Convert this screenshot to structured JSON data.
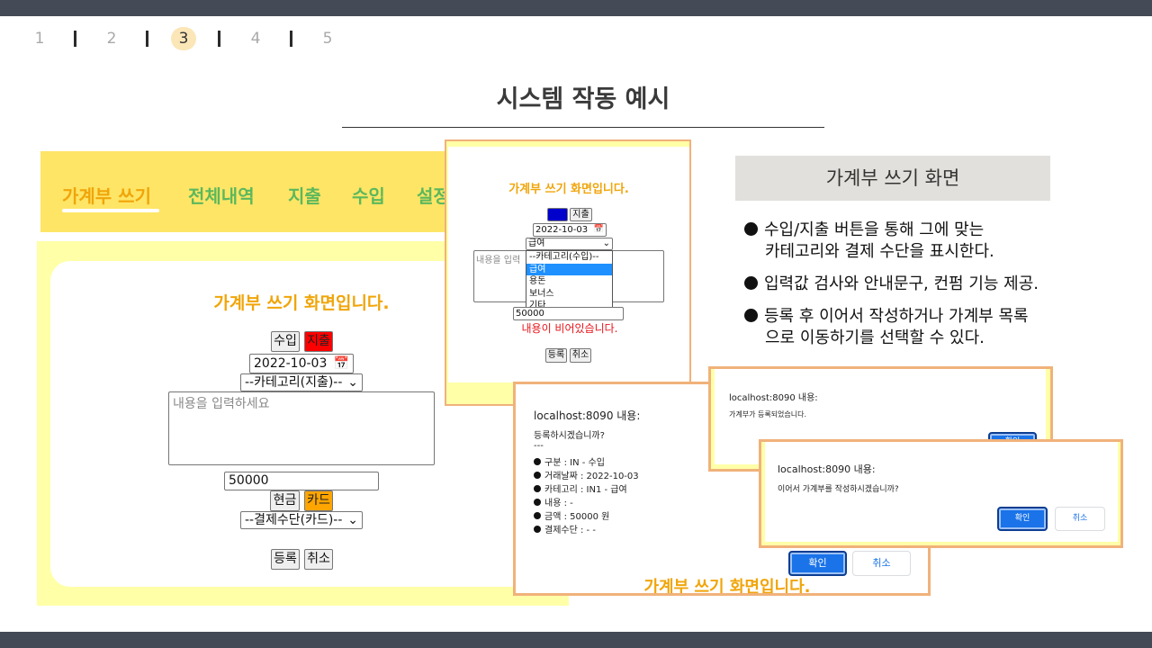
{
  "pager": {
    "pages": [
      "1",
      "2",
      "3",
      "4",
      "5"
    ],
    "active_index": 2
  },
  "slide": {
    "title": "시스템 작동 예시"
  },
  "app_nav": {
    "items": [
      "가계부 쓰기",
      "전체내역",
      "지출",
      "수입",
      "설정"
    ]
  },
  "form_main": {
    "heading": "가계부 쓰기 화면입니다.",
    "income_label": "수입",
    "expense_label": "지출",
    "date": "2022-10-03",
    "category_select": "--카테고리(지출)--",
    "content_placeholder": "내용을 입력하세요",
    "amount": "50000",
    "cash_label": "현금",
    "card_label": "카드",
    "payment_select": "--결제수단(카드)--",
    "register_label": "등록",
    "cancel_label": "취소"
  },
  "form_small": {
    "heading": "가계부 쓰기 화면입니다.",
    "expense_label": "지출",
    "date": "2022-10-03",
    "category_selected": "급여",
    "content_placeholder": "내용을 입력",
    "dropdown_options": [
      "--카테고리(수입)--",
      "급여",
      "용돈",
      "보너스",
      "기타"
    ],
    "dropdown_selected_index": 1,
    "amount": "50000",
    "error_message": "내용이 비어있습니다.",
    "register_label": "등록",
    "cancel_label": "취소"
  },
  "caption": {
    "title": "가계부 쓰기 화면"
  },
  "bullets": [
    {
      "line1": "수입/지출 버튼을 통해 그에 맞는",
      "line2": "카테고리와 결제 수단을 표시한다."
    },
    {
      "line1": "입력값 검사와 안내문구, 컨펌 기능 제공.",
      "line2": ""
    },
    {
      "line1": "등록 후 이어서 작성하거나 가계부 목록",
      "line2": "으로 이동하기를 선택할 수 있다."
    }
  ],
  "confirm_dialog": {
    "title": "localhost:8090 내용:",
    "question": "등록하시겠습니까?",
    "divider": "---",
    "lines": [
      "구분 : IN - 수입",
      "거래날짜 : 2022-10-03",
      "카테고리 : IN1 - 급여",
      "내용 : -",
      "금액 : 50000 원",
      "결제수단 : - -"
    ],
    "ok_label": "확인",
    "cancel_label": "취소",
    "underlying_heading": "가계부 쓰기 화면입니다."
  },
  "registered_dialog": {
    "title": "localhost:8090 내용:",
    "message": "가계부가 등록되었습니다.",
    "ok_label": "확인"
  },
  "continue_dialog": {
    "title": "localhost:8090 내용:",
    "message": "이어서 가계부를 작성하시겠습니까?",
    "ok_label": "확인",
    "cancel_label": "취소"
  },
  "colors": {
    "nav_bg": "#ffe566",
    "nav_active": "#f0a50a",
    "nav_item": "#5cb85c",
    "panel_bg": "#ffffa8",
    "dialog_border": "#f0b27a",
    "primary_button": "#1a73e8",
    "expense_active": "#ff0000",
    "card_active": "#ffa500",
    "error_text": "#e8141a"
  }
}
